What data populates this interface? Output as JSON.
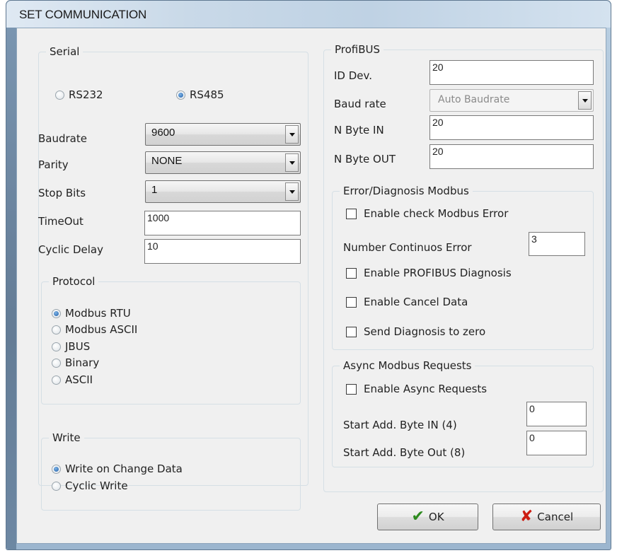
{
  "window": {
    "title": "SET COMMUNICATION"
  },
  "serial": {
    "label": "Serial",
    "rs232": "RS232",
    "rs485": "RS485",
    "selected": "RS485",
    "baudrate_label": "Baudrate",
    "baudrate_value": "9600",
    "parity_label": "Parity",
    "parity_value": "NONE",
    "stopbits_label": "Stop Bits",
    "stopbits_value": "1",
    "timeout_label": "TimeOut",
    "timeout_value": "1000",
    "cyclic_delay_label": "Cyclic Delay",
    "cyclic_delay_value": "10"
  },
  "protocol": {
    "label": "Protocol",
    "options": [
      "Modbus RTU",
      "Modbus ASCII",
      "JBUS",
      "Binary",
      "ASCII"
    ],
    "selected": "Modbus RTU"
  },
  "write": {
    "label": "Write",
    "options": [
      "Write on Change Data",
      "Cyclic Write"
    ],
    "selected": "Write on Change Data"
  },
  "profibus": {
    "label": "ProfiBUS",
    "id_label": "ID Dev.",
    "id_value": "20",
    "baud_label": "Baud rate",
    "baud_value": "Auto Baudrate",
    "nbyte_in_label": "N Byte IN",
    "nbyte_in_value": "20",
    "nbyte_out_label": "N Byte OUT",
    "nbyte_out_value": "20"
  },
  "diagnosis": {
    "label": "Error/Diagnosis Modbus",
    "check_modbus_error": "Enable check Modbus Error",
    "number_continuos_label": "Number Continuos Error",
    "number_continuos_value": "3",
    "profibus_diagnosis": "Enable PROFIBUS Diagnosis",
    "cancel_data": "Enable Cancel Data",
    "send_diag_zero": "Send Diagnosis to zero"
  },
  "async": {
    "label": "Async Modbus Requests",
    "enable": "Enable Async Requests",
    "start_in_label": "Start Add. Byte IN (4)",
    "start_in_value": "0",
    "start_out_label": "Start Add. Byte Out (8)",
    "start_out_value": "0"
  },
  "buttons": {
    "ok": "OK",
    "cancel": "Cancel"
  },
  "colors": {
    "ok_check": "#2e8b1f",
    "cancel_x": "#cc1d12"
  }
}
